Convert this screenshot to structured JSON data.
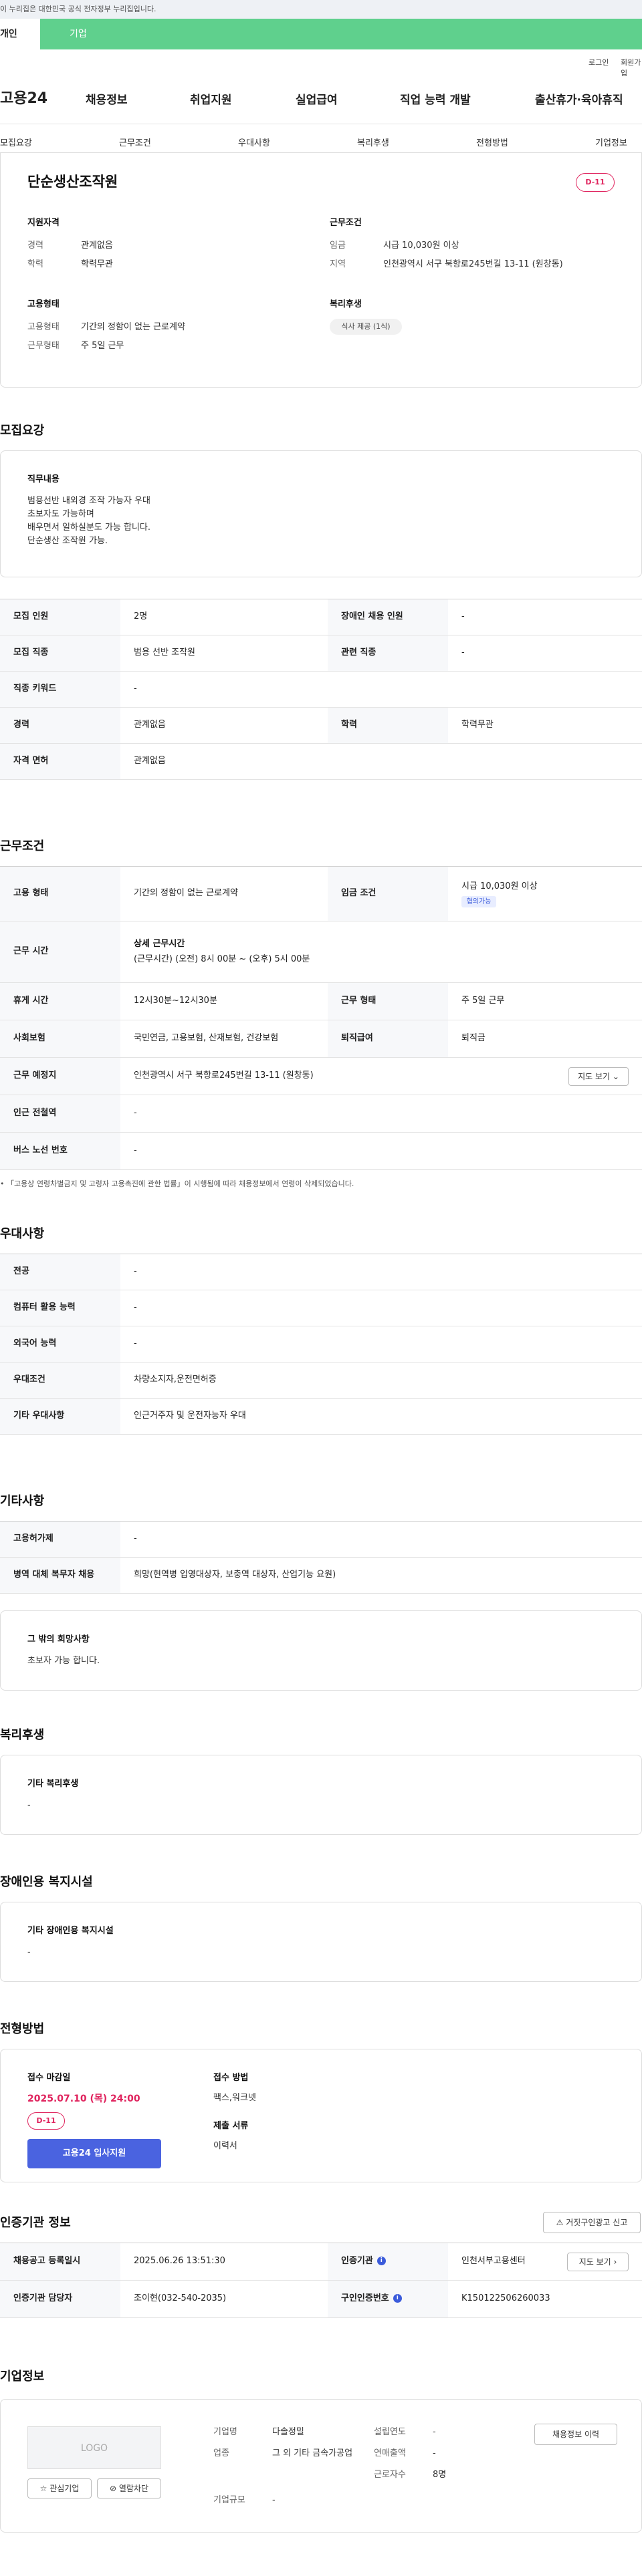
{
  "notice": "이 누리집은 대한민국 공식 전자정부 누리집입니다.",
  "gnb_tabs": [
    "개인",
    "기업"
  ],
  "util": [
    "로그인",
    "회원가입"
  ],
  "header": {
    "logo": "고용24",
    "menu": [
      "채용정보",
      "취업지원",
      "실업급여",
      "직업 능력 개발",
      "출산휴가·육아휴직"
    ]
  },
  "subnav": [
    "모집요강",
    "근무조건",
    "우대사항",
    "복리후생",
    "전형방법",
    "기업정보"
  ],
  "summary": {
    "title": "단순생산조작원",
    "dday": "D-11",
    "qual_title": "지원자격",
    "qual": [
      {
        "label": "경력",
        "value": "관계없음"
      },
      {
        "label": "학력",
        "value": "학력무관"
      }
    ],
    "cond_title": "근무조건",
    "cond": [
      {
        "label": "임금",
        "value": "시급 10,030원 이상"
      },
      {
        "label": "지역",
        "value": "인천광역시 서구 북항로245번길 13-11 (원창동)"
      }
    ],
    "emp_title": "고용형태",
    "emp": [
      {
        "label": "고용형태",
        "value": "기간의 정함이 없는 근로계약"
      },
      {
        "label": "근무형태",
        "value": "주 5일 근무"
      }
    ],
    "welfare_title": "복리후생",
    "welfare_tag": "식사 제공 (1식)"
  },
  "recruit": {
    "heading": "모집요강",
    "duty_title": "직무내용",
    "duty_lines": [
      "범용선반 내외경 조작 가능자 우대",
      "초보자도 가능하며",
      "배우면서 일하실분도 가능 합니다.",
      "단순생산 조작원 가능."
    ],
    "rows": [
      {
        "th1": "모집 인원",
        "td1": "2명",
        "th2": "장애인 채용 인원",
        "td2": "-"
      },
      {
        "th1": "모집 직종",
        "td1": "범용 선반 조작원",
        "th2": "관련 직종",
        "td2": "-"
      },
      {
        "th1": "직종 키워드",
        "td1": "-"
      },
      {
        "th1": "경력",
        "td1": "관계없음",
        "th2": "학력",
        "td2": "학력무관"
      },
      {
        "th1": "자격 면허",
        "td1": "관계없음"
      }
    ]
  },
  "work": {
    "heading": "근무조건",
    "emp_type_th": "고용 형태",
    "emp_type": "기간의 정함이 없는 근로계약",
    "wage_th": "임금 조건",
    "wage": "시급 10,030원 이상",
    "wage_tag": "협의가능",
    "hours_th": "근무 시간",
    "hours_title": "상세 근무시간",
    "hours": "(근무시간) (오전) 8시 00분 ~ (오후) 5시 00분",
    "rest_th": "휴게 시간",
    "rest": "12시30분~12시30분",
    "form_th": "근무 형태",
    "form": "주 5일 근무",
    "ins_th": "사회보험",
    "ins": "국민연금, 고용보험, 산재보험, 건강보험",
    "sev_th": "퇴직급여",
    "sev": "퇴직금",
    "place_th": "근무 예정지",
    "place": "인천광역시 서구 북항로245번길 13-11 (원창동)",
    "map_btn": "지도 보기",
    "subway_th": "인근 전철역",
    "subway": "-",
    "bus_th": "버스 노선 번호",
    "bus": "-",
    "note": "「고용상 연령차별금지 및 고령자 고용촉진에 관한 법률」이 시행됨에 따라 채용정보에서 연령이 삭제되었습니다."
  },
  "pref": {
    "heading": "우대사항",
    "rows": [
      {
        "th": "전공",
        "td": "-"
      },
      {
        "th": "컴퓨터 활용 능력",
        "td": "-"
      },
      {
        "th": "외국어 능력",
        "td": "-"
      },
      {
        "th": "우대조건",
        "td": "차량소지자,운전면허증"
      },
      {
        "th": "기타 우대사항",
        "td": "인근거주자 및 운전자능자 우대"
      }
    ]
  },
  "etc": {
    "heading": "기타사항",
    "rows": [
      {
        "th": "고용허가제",
        "td": "-"
      },
      {
        "th": "병역 대체 복무자 채용",
        "td": "희망(현역병 입영대상자, 보충역 대상자, 산업기능 요원)"
      }
    ],
    "box_title": "그 밖의 희망사항",
    "box_text": "초보자 가능 합니다."
  },
  "welfare": {
    "heading": "복리후생",
    "box_title": "기타 복리후생",
    "box_text": "-"
  },
  "disabled": {
    "heading": "장애인용 복지시설",
    "box_title": "기타 장애인용 복지시설",
    "box_text": "-"
  },
  "selection": {
    "heading": "전형방법",
    "deadline_title": "접수 마감일",
    "deadline": "2025.07.10 (목) 24:00",
    "dday": "D-11",
    "apply_btn": "고용24 입사지원",
    "method_title": "접수 방법",
    "method": "팩스,워크넷",
    "docs_title": "제출 서류",
    "docs": "이력서"
  },
  "cert": {
    "heading": "인증기관 정보",
    "report_btn": "거짓구인광고 신고",
    "reg_th": "채용공고 등록일시",
    "reg": "2025.06.26 13:51:30",
    "org_th": "인증기관",
    "org": "인천서부고용센터",
    "map_btn": "지도 보기",
    "mgr_th": "인증기관 담당자",
    "mgr": "조이현(032-540-2035)",
    "no_th": "구인인증번호",
    "no": "K150122506260033"
  },
  "company": {
    "heading": "기업정보",
    "logo": "LOGO",
    "fav_btn": "관심기업",
    "block_btn": "열람차단",
    "fields": [
      {
        "label": "기업명",
        "value": "다솔정밀"
      },
      {
        "label": "업종",
        "value": "그 외 기타 금속가공업"
      },
      {
        "label": "기업규모",
        "value": "-"
      },
      {
        "label": "설립연도",
        "value": "-"
      },
      {
        "label": "연매출액",
        "value": "-"
      },
      {
        "label": "근로자수",
        "value": "8명"
      }
    ],
    "history_btn": "채용정보 이력"
  }
}
